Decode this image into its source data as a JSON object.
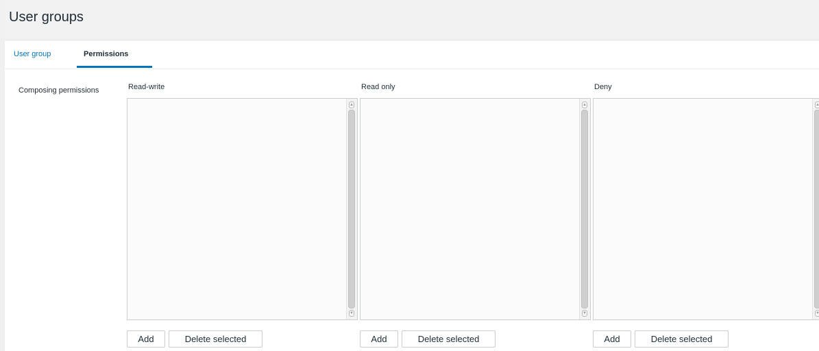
{
  "header": {
    "title": "User groups"
  },
  "tabs": [
    {
      "label": "User group",
      "active": false
    },
    {
      "label": "Permissions",
      "active": true
    }
  ],
  "form": {
    "label": "Composing permissions",
    "columns": [
      {
        "title": "Read-write",
        "add_label": "Add",
        "delete_label": "Delete selected"
      },
      {
        "title": "Read only",
        "add_label": "Add",
        "delete_label": "Delete selected"
      },
      {
        "title": "Deny",
        "add_label": "Add",
        "delete_label": "Delete selected"
      }
    ]
  },
  "colors": {
    "accent": "#0275b8",
    "header_bg": "#f2f2f2",
    "text": "#1f2c33",
    "border": "#c8cdd0"
  },
  "icons": {
    "scroll_up": "chevron-up-icon",
    "scroll_down": "chevron-down-icon"
  }
}
